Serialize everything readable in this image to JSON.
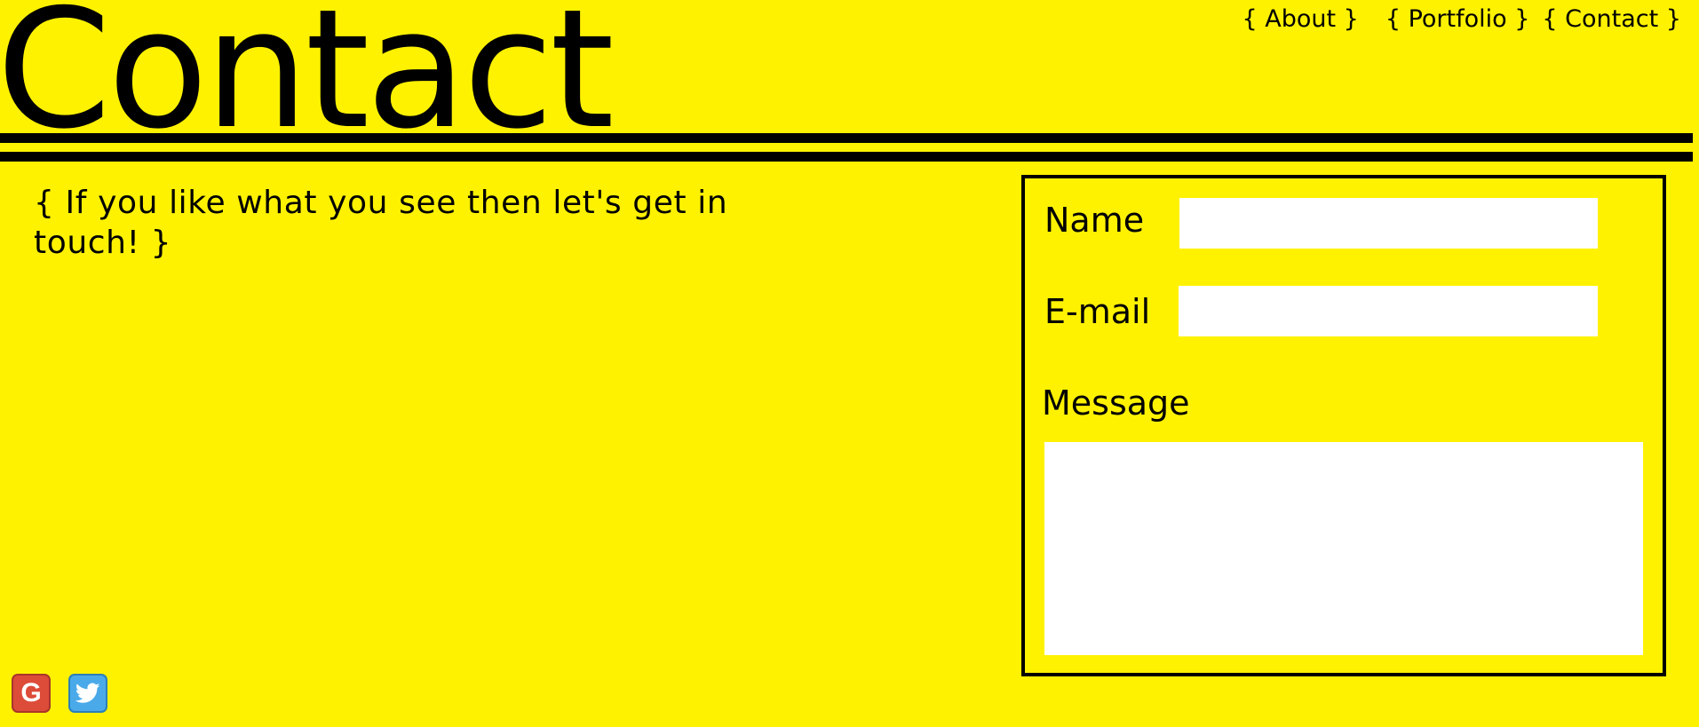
{
  "header": {
    "title": "Contact",
    "nav": [
      {
        "label": "{ About }"
      },
      {
        "label": "{ Portfolio }"
      },
      {
        "label": "{ Contact }"
      }
    ]
  },
  "intro": {
    "text": "{ If you like what you see then let's get in touch! }"
  },
  "form": {
    "name_label": "Name",
    "name_value": "",
    "email_label": "E-mail",
    "email_value": "",
    "message_label": "Message",
    "message_value": ""
  },
  "social": [
    {
      "name": "google",
      "icon": "google-icon",
      "color": "#dd4b39"
    },
    {
      "name": "twitter",
      "icon": "twitter-icon",
      "color": "#4aa9e9"
    }
  ],
  "colors": {
    "background": "#fff200",
    "foreground": "#000000",
    "field_background": "#ffffff"
  }
}
